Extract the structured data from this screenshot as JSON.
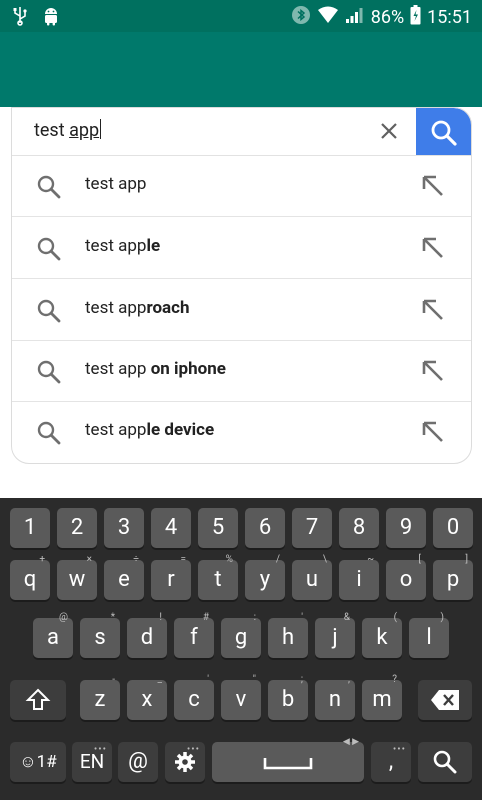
{
  "status_bar": {
    "battery": "86%",
    "time": "15:51"
  },
  "search": {
    "query_plain": "test ",
    "query_underlined": "app"
  },
  "suggestions": [
    {
      "plain": "test app",
      "bold": ""
    },
    {
      "plain": "test app",
      "bold": "le"
    },
    {
      "plain": "test app",
      "bold": "roach"
    },
    {
      "plain": "test app",
      "bold": " on iphone"
    },
    {
      "plain": "test app",
      "bold": "le device"
    }
  ],
  "keyboard": {
    "number_row": [
      "1",
      "2",
      "3",
      "4",
      "5",
      "6",
      "7",
      "8",
      "9",
      "0"
    ],
    "row1": [
      "q",
      "w",
      "e",
      "r",
      "t",
      "y",
      "u",
      "i",
      "o",
      "p"
    ],
    "row1_hints": [
      "+",
      "×",
      "÷",
      "=",
      "%",
      "/",
      "\\",
      "~",
      "[",
      "]"
    ],
    "row2": [
      "a",
      "s",
      "d",
      "f",
      "g",
      "h",
      "j",
      "k",
      "l"
    ],
    "row2_hints": [
      "@",
      "*",
      "!",
      "#",
      ":",
      "'",
      "&",
      "(",
      ")"
    ],
    "row3": [
      "z",
      "x",
      "c",
      "v",
      "b",
      "n",
      "m"
    ],
    "row3_hints": [
      "-",
      "_",
      "'",
      "\"",
      ";",
      ",",
      "?"
    ],
    "symbols_label": "☺1#",
    "language_label": "EN",
    "at_label": "@",
    "comma_label": ","
  },
  "colors": {
    "status_bar": "#00705f",
    "app_bar": "#00796b",
    "search_button": "#3f7de9",
    "keyboard_bg": "#2b2b2b",
    "key_bg": "#5a5a5a"
  }
}
